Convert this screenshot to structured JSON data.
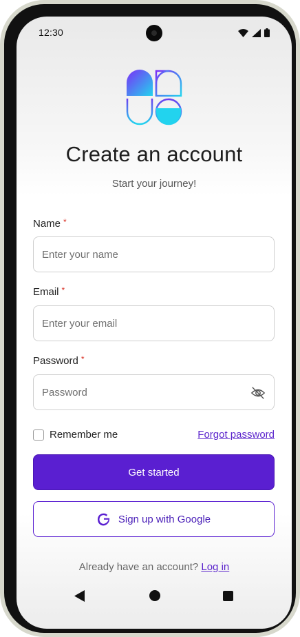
{
  "status_bar": {
    "time": "12:30",
    "icons": [
      "wifi-icon",
      "signal-icon",
      "battery-icon"
    ]
  },
  "header": {
    "logo_icon": "app-logo",
    "title": "Create an account",
    "subtitle": "Start your journey!"
  },
  "form": {
    "name": {
      "label": "Name",
      "required_mark": "*",
      "placeholder": "Enter your name",
      "value": ""
    },
    "email": {
      "label": "Email",
      "required_mark": "*",
      "placeholder": "Enter your email",
      "value": ""
    },
    "password": {
      "label": "Password",
      "required_mark": "*",
      "placeholder": "Password",
      "value": "",
      "toggle_icon": "eye-off-icon"
    },
    "remember_me": {
      "label": "Remember me",
      "checked": false
    },
    "forgot_password": "Forgot password",
    "submit_label": "Get started",
    "google_label": "Sign up with Google"
  },
  "footer": {
    "prompt": "Already have an account?",
    "login_link": "Log in"
  },
  "nav_bar": {
    "icons": [
      "back-icon",
      "home-icon",
      "recents-icon"
    ]
  },
  "colors": {
    "primary": "#5a1fd1",
    "link": "#5b24cc",
    "required": "#d93025",
    "logo_gradient_start": "#7b2ff7",
    "logo_gradient_end": "#22d3ee"
  }
}
